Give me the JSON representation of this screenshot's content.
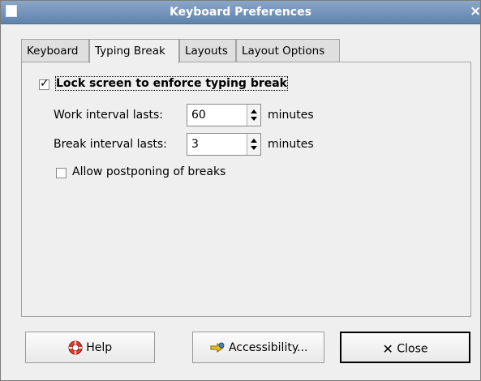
{
  "window": {
    "title": "Keyboard Preferences"
  },
  "tabs": [
    {
      "label": "Keyboard"
    },
    {
      "label": "Typing Break"
    },
    {
      "label": "Layouts"
    },
    {
      "label": "Layout Options"
    }
  ],
  "typing_break": {
    "lock_label": "Lock screen to enforce typing break",
    "lock_checked": true,
    "work_label": "Work interval lasts:",
    "work_value": "60",
    "break_label": "Break interval lasts:",
    "break_value": "3",
    "minutes": "minutes",
    "postpone_label": "Allow postponing of breaks",
    "postpone_checked": false
  },
  "buttons": {
    "help": "Help",
    "accessibility": "Accessibility...",
    "close": "Close"
  },
  "icons": {
    "window": "window-icon",
    "close": "close-icon",
    "help": "lifebuoy-icon",
    "accessibility": "accessibility-icon",
    "close_button": "x-icon"
  }
}
